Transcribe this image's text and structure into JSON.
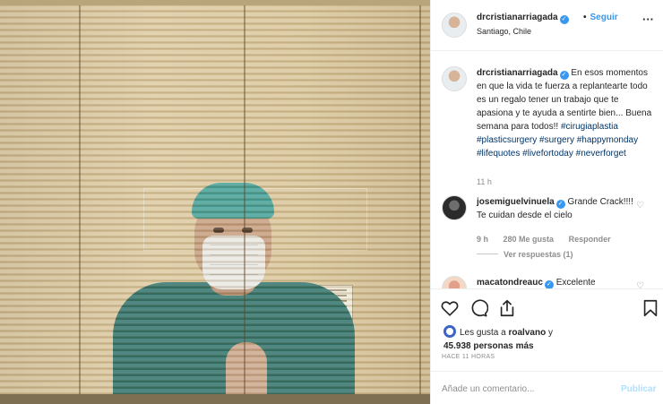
{
  "header": {
    "username": "drcristianarriagada",
    "follow_label": "Seguir",
    "location": "Santiago, Chile"
  },
  "caption": {
    "username": "drcristianarriagada",
    "text": "En esos momentos en que la vida te fuerza a replantearte todo es un regalo tener un trabajo que te apasiona y te ayuda a sentirte bien... Buena semana para todos!!",
    "hashtags": [
      "#cirugiaplastia",
      "#plasticsurgery",
      "#surgery",
      "#happymonday",
      "#lifequotes",
      "#livefortoday",
      "#neverforget"
    ],
    "time": "11 h"
  },
  "comments": [
    {
      "username": "josemiguelvinuela",
      "text": "Grande Crack!!!! Te cuidan desde el cielo",
      "time": "9 h",
      "likes": "280 Me gusta",
      "reply": "Responder",
      "view_replies": "Ver respuestas (1)"
    },
    {
      "username": "macatondreauc",
      "text": "Excelente"
    }
  ],
  "likes": {
    "prefix": "Les gusta a",
    "user": "roalvano",
    "suffix": "y",
    "count": "45.938 personas más"
  },
  "timestamp": "HACE 11 HORAS",
  "composer": {
    "placeholder": "Añade un comentario...",
    "publish_label": "Publicar"
  },
  "icons": [
    "heart-icon",
    "comment-icon",
    "share-icon",
    "bookmark-icon",
    "more-options-icon",
    "verified-icon"
  ],
  "colors": {
    "link": "#3897f0",
    "hashtag": "#003569",
    "muted": "#8e8e8e",
    "publish_disabled": "#b2dffc"
  }
}
